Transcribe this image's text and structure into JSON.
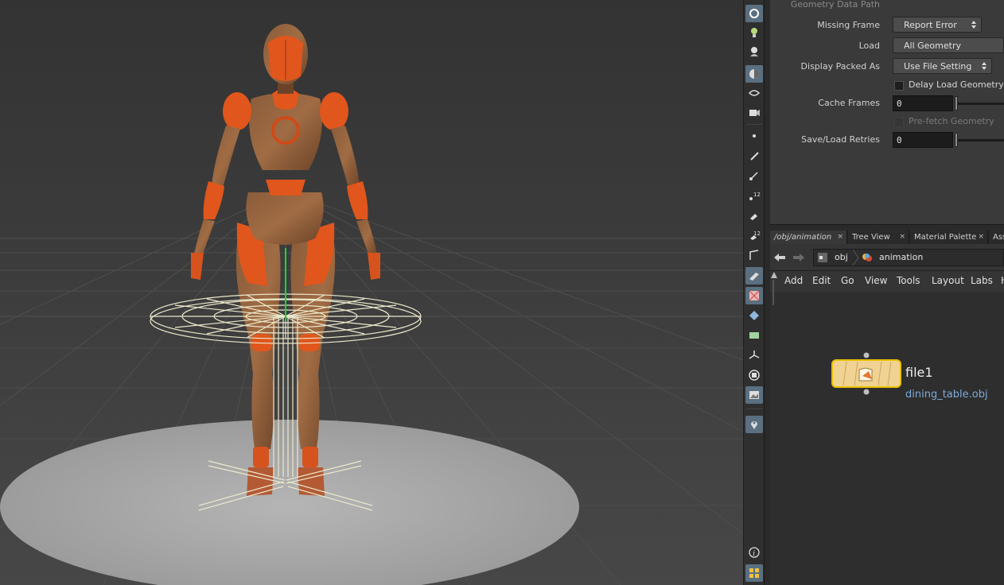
{
  "params": {
    "geometry_data_path_label": "Geometry Data Path",
    "missing_frame_label": "Missing Frame",
    "missing_frame_value": "Report Error",
    "load_label": "Load",
    "load_value": "All Geometry",
    "display_packed_as_label": "Display Packed As",
    "display_packed_as_value": "Use File Setting",
    "delay_load_label": "Delay Load Geometry",
    "cache_frames_label": "Cache Frames",
    "cache_frames_value": "0",
    "prefetch_label": "Pre-fetch Geometry",
    "save_load_retries_label": "Save/Load Retries",
    "save_load_retries_value": "0"
  },
  "network": {
    "tabs": [
      {
        "label": "/obj/animation"
      },
      {
        "label": "Tree View"
      },
      {
        "label": "Material Palette"
      },
      {
        "label": "Ass"
      }
    ],
    "tab_close": "×",
    "path": [
      "obj",
      "animation"
    ],
    "menu": [
      "Add",
      "Edit",
      "Go",
      "View",
      "Tools",
      "Layout",
      "Labs",
      "H"
    ],
    "node": {
      "name": "file1",
      "file": "dining_table.obj"
    }
  },
  "toolbar": {
    "icons": [
      "select-icon",
      "light-icon",
      "ghost-icon",
      "shading-icon",
      "visibility-icon",
      "camera-icon",
      "point-icon",
      "brush-icon",
      "pencil-icon",
      "number-icon",
      "paint-icon",
      "number-alt-icon",
      "corner-icon",
      "snap-icon",
      "texture-icon",
      "diamond-icon",
      "map-icon",
      "axis-icon",
      "circle-icon",
      "background-icon",
      "pin-icon",
      "info-icon",
      "grid-icon"
    ]
  },
  "colors": {
    "accent": "#5a6f80",
    "node_fill": "#f0d393",
    "node_border": "#e8c000",
    "link": "#7fa9d8"
  }
}
